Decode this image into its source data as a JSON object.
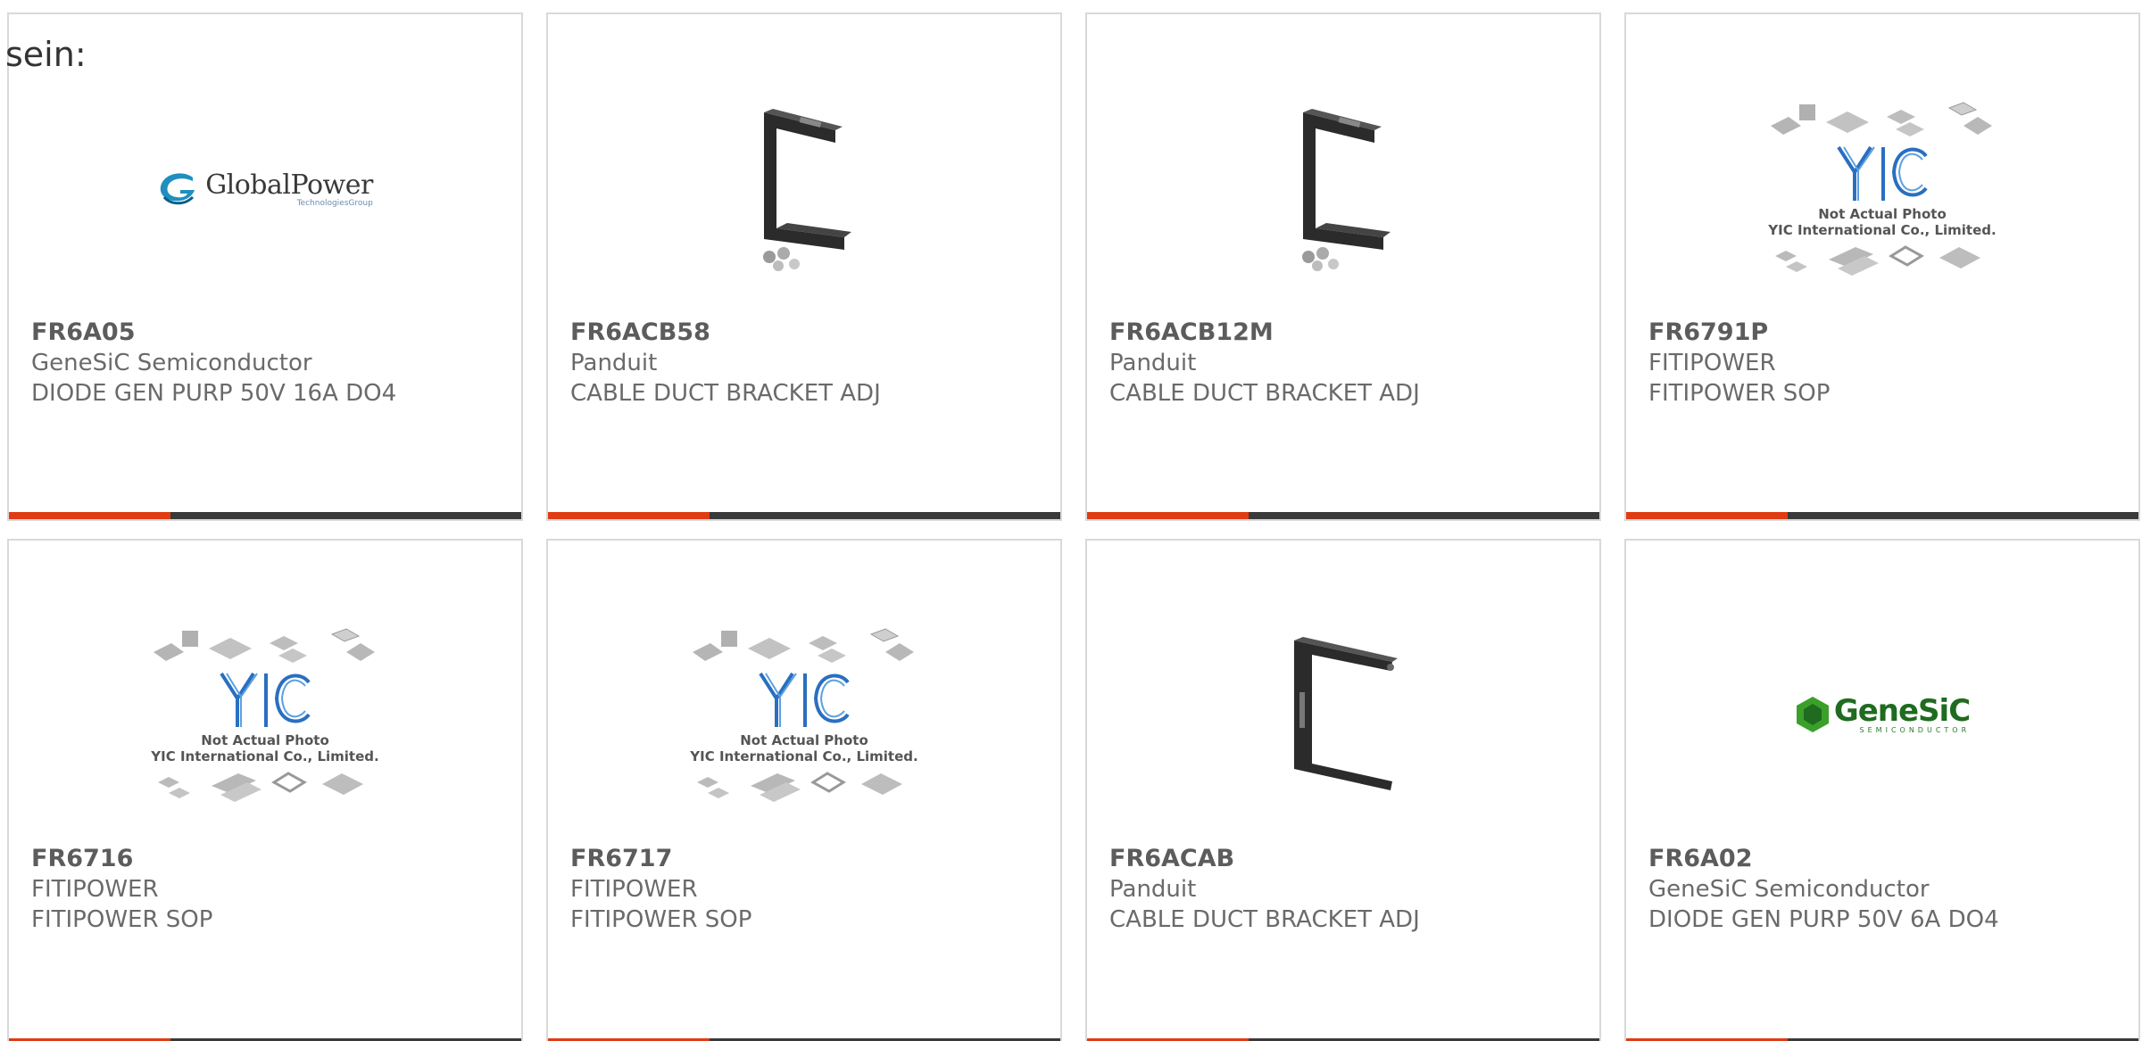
{
  "intro_text": "sein:",
  "colors": {
    "accent_red": "#e03c14",
    "accent_dark": "#3a3a3a",
    "card_border": "#d9d9d9"
  },
  "placeholder": {
    "line1": "Not Actual Photo",
    "line2": "YIC International Co., Limited.",
    "logo_text": "YIC"
  },
  "logos": {
    "globalpower": {
      "main": "GlobalPower",
      "sub": "TechnologiesGroup"
    },
    "genesic": {
      "main": "GeneSiC",
      "sub": "SEMICONDUCTOR"
    }
  },
  "products": [
    {
      "part": "FR6A05",
      "manufacturer": "GeneSiC Semiconductor",
      "description": "DIODE GEN PURP 50V 16A DO4",
      "image": "globalpower-logo"
    },
    {
      "part": "FR6ACB58",
      "manufacturer": "Panduit",
      "description": "CABLE DUCT BRACKET ADJ",
      "image": "bracket-c"
    },
    {
      "part": "FR6ACB12M",
      "manufacturer": "Panduit",
      "description": "CABLE DUCT BRACKET ADJ",
      "image": "bracket-c"
    },
    {
      "part": "FR6791P",
      "manufacturer": "FITIPOWER",
      "description": "FITIPOWER SOP",
      "image": "yic-placeholder"
    },
    {
      "part": "FR6716",
      "manufacturer": "FITIPOWER",
      "description": "FITIPOWER SOP",
      "image": "yic-placeholder"
    },
    {
      "part": "FR6717",
      "manufacturer": "FITIPOWER",
      "description": "FITIPOWER SOP",
      "image": "yic-placeholder"
    },
    {
      "part": "FR6ACAB",
      "manufacturer": "Panduit",
      "description": "CABLE DUCT BRACKET ADJ",
      "image": "bracket-u"
    },
    {
      "part": "FR6A02",
      "manufacturer": "GeneSiC Semiconductor",
      "description": "DIODE GEN PURP 50V 6A DO4",
      "image": "genesic-logo"
    }
  ]
}
